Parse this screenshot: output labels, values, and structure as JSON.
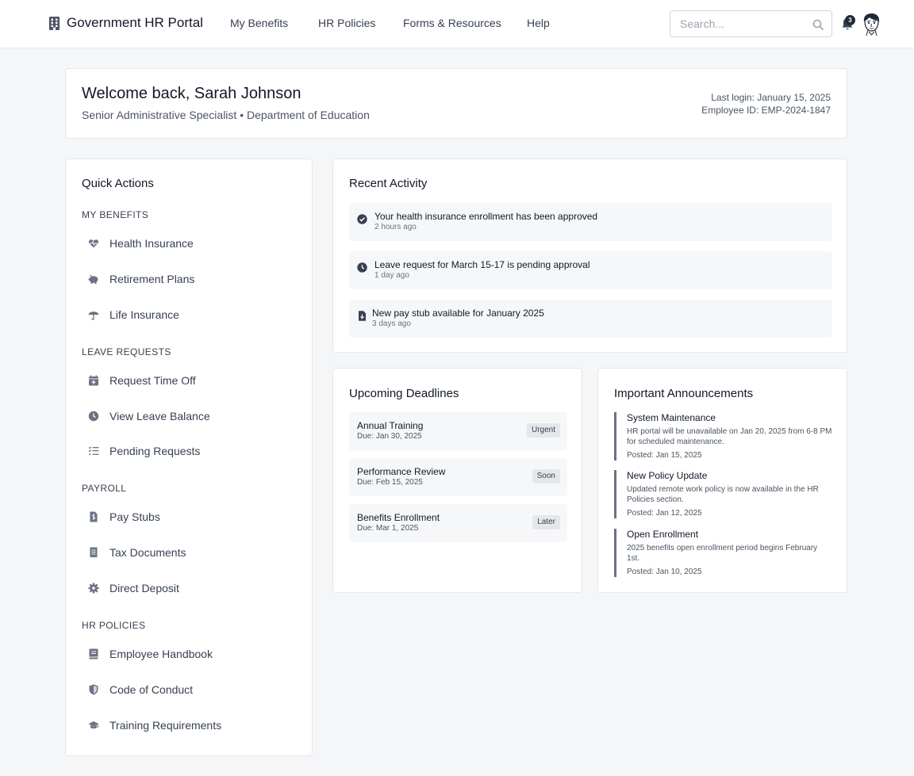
{
  "header": {
    "brand": "Government HR Portal",
    "nav": [
      {
        "label": "My Benefits"
      },
      {
        "label": "HR Policies"
      },
      {
        "label": "Forms & Resources"
      },
      {
        "label": "Help"
      }
    ],
    "search_placeholder": "Search...",
    "notification_count": "3"
  },
  "welcome": {
    "title": "Welcome back, Sarah Johnson",
    "subtitle": "Senior Administrative Specialist • Department of Education",
    "last_login": "Last login: January 15, 2025",
    "employee_id": "Employee ID: EMP-2024-1847"
  },
  "quick_actions": {
    "title": "Quick Actions",
    "sections": [
      {
        "label": "MY BENEFITS",
        "items": [
          {
            "label": "Health Insurance",
            "icon": "heart-pulse-icon"
          },
          {
            "label": "Retirement Plans",
            "icon": "piggy-bank-icon"
          },
          {
            "label": "Life Insurance",
            "icon": "umbrella-icon"
          }
        ]
      },
      {
        "label": "LEAVE REQUESTS",
        "items": [
          {
            "label": "Request Time Off",
            "icon": "calendar-plus-icon"
          },
          {
            "label": "View Leave Balance",
            "icon": "clock-icon"
          },
          {
            "label": "Pending Requests",
            "icon": "list-check-icon"
          }
        ]
      },
      {
        "label": "PAYROLL",
        "items": [
          {
            "label": "Pay Stubs",
            "icon": "file-dollar-icon"
          },
          {
            "label": "Tax Documents",
            "icon": "receipt-icon"
          },
          {
            "label": "Direct Deposit",
            "icon": "gear-icon"
          }
        ]
      },
      {
        "label": "HR POLICIES",
        "items": [
          {
            "label": "Employee Handbook",
            "icon": "book-icon"
          },
          {
            "label": "Code of Conduct",
            "icon": "shield-icon"
          },
          {
            "label": "Training Requirements",
            "icon": "graduation-cap-icon"
          }
        ]
      }
    ]
  },
  "activity": {
    "title": "Recent Activity",
    "items": [
      {
        "text": "Your health insurance enrollment has been approved",
        "time": "2 hours ago",
        "icon": "check-circle-icon"
      },
      {
        "text": "Leave request for March 15-17 is pending approval",
        "time": "1 day ago",
        "icon": "clock-icon"
      },
      {
        "text": "New pay stub available for January 2025",
        "time": "3 days ago",
        "icon": "file-download-icon"
      }
    ]
  },
  "deadlines": {
    "title": "Upcoming Deadlines",
    "items": [
      {
        "name": "Annual Training",
        "due": "Due: Jan 30, 2025",
        "badge": "Urgent"
      },
      {
        "name": "Performance Review",
        "due": "Due: Feb 15, 2025",
        "badge": "Soon"
      },
      {
        "name": "Benefits Enrollment",
        "due": "Due: Mar 1, 2025",
        "badge": "Later"
      }
    ]
  },
  "announcements": {
    "title": "Important Announcements",
    "items": [
      {
        "title": "System Maintenance",
        "body": "HR portal will be unavailable on Jan 20, 2025 from 6-8 PM for scheduled maintenance.",
        "date": "Posted: Jan 15, 2025"
      },
      {
        "title": "New Policy Update",
        "body": "Updated remote work policy is now available in the HR Policies section.",
        "date": "Posted: Jan 12, 2025"
      },
      {
        "title": "Open Enrollment",
        "body": "2025 benefits open enrollment period begins February 1st.",
        "date": "Posted: Jan 10, 2025"
      }
    ]
  },
  "colors": {
    "icon": "#6b7280",
    "text": "#1f2937",
    "accent_bar": "#6b7280",
    "background": "#f5f6f8"
  }
}
